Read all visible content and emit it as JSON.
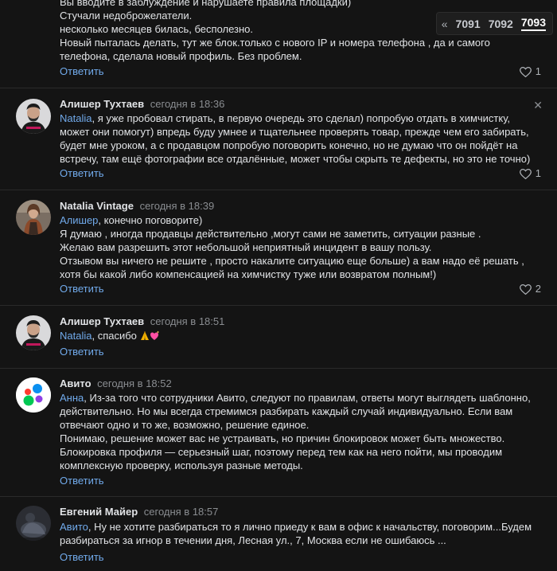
{
  "pager": {
    "prev_symbol": "«",
    "pages": [
      "7091",
      "7092",
      "7093"
    ],
    "current": "7093"
  },
  "top_comment": {
    "lines": [
      "Вы вводите в заблуждение и нарушаете правила площадки)",
      "Стучали недоброжелатели.",
      "несколько месяцев билась, бесполезно.",
      "Новый пыталась делать, тут же блок.только с нового IP и номера телефона , да и самого телефона, сделала новый профиль. Без проблем."
    ],
    "reply_label": "Ответить",
    "likes": "1"
  },
  "comments": [
    {
      "author": "Алишер Тухтаев",
      "time": "сегодня в 18:36",
      "mention": "Natalia",
      "text": ", я уже пробовал стирать, в первую очередь это сделал) попробую отдать в химчистку, может они помогут) впредь буду умнее и тщательнее проверять товар, прежде чем его забирать, будет мне уроком, а с продавцом попробую поговорить конечно, но не думаю что он пойдёт на встречу, там ещё фотографии все отдалённые, может чтобы скрыть те дефекты, но это не точно)",
      "reply_label": "Ответить",
      "likes": "1",
      "close_symbol": "✕"
    },
    {
      "author": "Natalia Vintage",
      "time": "сегодня в 18:39",
      "mention": "Алишер",
      "text": ", конечно поговорите)",
      "extra_lines": [
        "Я думаю , иногда продавцы действительно ,могут сами не заметить, ситуации разные .",
        "Желаю вам разрешить этот небольшой неприятный инцидент в вашу пользу.",
        "Отзывом вы ничего не решите , просто накалите ситуацию еще больше) а вам надо её решать , хотя бы какой либо компенсацией на химчистку туже или возвратом полным!)"
      ],
      "reply_label": "Ответить",
      "likes": "2"
    },
    {
      "author": "Алишер Тухтаев",
      "time": "сегодня в 18:51",
      "mention": "Natalia",
      "text": ", спасибо",
      "reply_label": "Ответить"
    },
    {
      "author": "Авито",
      "time": "сегодня в 18:52",
      "mention": "Анна",
      "text": ", Из-за того что сотрудники Авито, следуют по правилам, ответы могут выглядеть шаблонно, действительно. Но мы всегда стремимся разбирать каждый случай индивидуально. Если вам отвечают одно и то же, возможно, решение единое.",
      "extra_lines": [
        "Понимаю, решение может вас не устраивать, но причин блокировок может быть множество. Блокировка профиля — серьезный шаг, поэтому перед тем как на него пойти, мы проводим комплексную проверку, используя разные методы."
      ],
      "reply_label": "Ответить"
    },
    {
      "author": "Евгений Майер",
      "time": "сегодня в 18:57",
      "mention": "Авито",
      "text": ", Ну не хотите разбираться то я лично приеду к вам в офис к начальству, поговорим...Будем разбираться за игнор в течении дня, Лесная ул., 7, Москва если не ошибаюсь ...",
      "reply_label": "Ответить"
    }
  ],
  "colors": {
    "background": "#141414",
    "text": "#e1e3e6",
    "link": "#71aaeb",
    "muted": "#8a8d91",
    "avito_green": "#00c853",
    "avito_blue": "#0a8ff0",
    "avito_red": "#ff3b30",
    "avito_purple": "#8f3fe4"
  }
}
